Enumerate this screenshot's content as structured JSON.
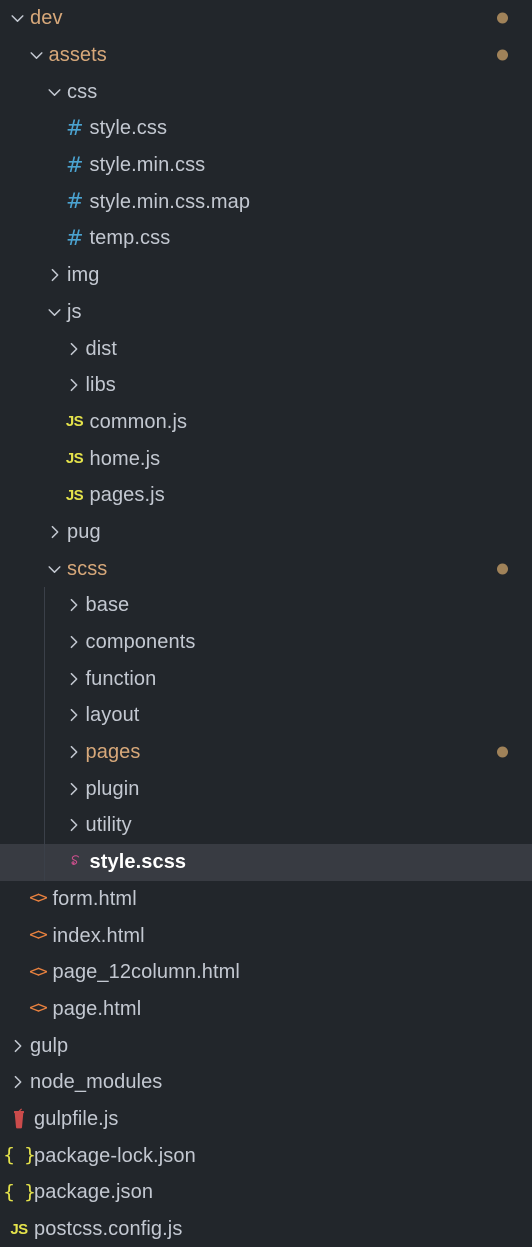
{
  "theme": {
    "background": "#22262b",
    "selected_row_background": "#383b42",
    "text_color": "#c3c8d1",
    "modified_color": "#d7a87a",
    "selected_text_color": "#ffffff",
    "badge_dot_color": "#a08259",
    "indent_guide_color": "#3b4049",
    "icon_css_color": "#4ba3d1",
    "icon_js_color": "#e5e34b",
    "icon_json_color": "#e5e34b",
    "icon_html_color": "#e8813f",
    "icon_scss_color": "#cf4f8e",
    "icon_gulp_color": "#cb4b4b"
  },
  "tree": [
    {
      "label": "dev",
      "depth": 0,
      "kind": "folder",
      "icon": "chevron-down-icon",
      "expanded": true,
      "modified": true,
      "dot": true,
      "selected": false,
      "guide": false
    },
    {
      "label": "assets",
      "depth": 1,
      "kind": "folder",
      "icon": "chevron-down-icon",
      "expanded": true,
      "modified": true,
      "dot": true,
      "selected": false,
      "guide": false
    },
    {
      "label": "css",
      "depth": 2,
      "kind": "folder",
      "icon": "chevron-down-icon",
      "expanded": true,
      "modified": false,
      "dot": false,
      "selected": false,
      "guide": false
    },
    {
      "label": "style.css",
      "depth": 3,
      "kind": "file",
      "icon": "css-file-icon",
      "expanded": false,
      "modified": false,
      "dot": false,
      "selected": false,
      "guide": false
    },
    {
      "label": "style.min.css",
      "depth": 3,
      "kind": "file",
      "icon": "css-file-icon",
      "expanded": false,
      "modified": false,
      "dot": false,
      "selected": false,
      "guide": false
    },
    {
      "label": "style.min.css.map",
      "depth": 3,
      "kind": "file",
      "icon": "css-file-icon",
      "expanded": false,
      "modified": false,
      "dot": false,
      "selected": false,
      "guide": false
    },
    {
      "label": "temp.css",
      "depth": 3,
      "kind": "file",
      "icon": "css-file-icon",
      "expanded": false,
      "modified": false,
      "dot": false,
      "selected": false,
      "guide": false
    },
    {
      "label": "img",
      "depth": 2,
      "kind": "folder",
      "icon": "chevron-right-icon",
      "expanded": false,
      "modified": false,
      "dot": false,
      "selected": false,
      "guide": false
    },
    {
      "label": "js",
      "depth": 2,
      "kind": "folder",
      "icon": "chevron-down-icon",
      "expanded": true,
      "modified": false,
      "dot": false,
      "selected": false,
      "guide": false
    },
    {
      "label": "dist",
      "depth": 3,
      "kind": "folder",
      "icon": "chevron-right-icon",
      "expanded": false,
      "modified": false,
      "dot": false,
      "selected": false,
      "guide": false
    },
    {
      "label": "libs",
      "depth": 3,
      "kind": "folder",
      "icon": "chevron-right-icon",
      "expanded": false,
      "modified": false,
      "dot": false,
      "selected": false,
      "guide": false
    },
    {
      "label": "common.js",
      "depth": 3,
      "kind": "file",
      "icon": "js-file-icon",
      "expanded": false,
      "modified": false,
      "dot": false,
      "selected": false,
      "guide": false
    },
    {
      "label": "home.js",
      "depth": 3,
      "kind": "file",
      "icon": "js-file-icon",
      "expanded": false,
      "modified": false,
      "dot": false,
      "selected": false,
      "guide": false
    },
    {
      "label": "pages.js",
      "depth": 3,
      "kind": "file",
      "icon": "js-file-icon",
      "expanded": false,
      "modified": false,
      "dot": false,
      "selected": false,
      "guide": false
    },
    {
      "label": "pug",
      "depth": 2,
      "kind": "folder",
      "icon": "chevron-right-icon",
      "expanded": false,
      "modified": false,
      "dot": false,
      "selected": false,
      "guide": false
    },
    {
      "label": "scss",
      "depth": 2,
      "kind": "folder",
      "icon": "chevron-down-icon",
      "expanded": true,
      "modified": true,
      "dot": true,
      "selected": false,
      "guide": false
    },
    {
      "label": "base",
      "depth": 3,
      "kind": "folder",
      "icon": "chevron-right-icon",
      "expanded": false,
      "modified": false,
      "dot": false,
      "selected": false,
      "guide": true
    },
    {
      "label": "components",
      "depth": 3,
      "kind": "folder",
      "icon": "chevron-right-icon",
      "expanded": false,
      "modified": false,
      "dot": false,
      "selected": false,
      "guide": true
    },
    {
      "label": "function",
      "depth": 3,
      "kind": "folder",
      "icon": "chevron-right-icon",
      "expanded": false,
      "modified": false,
      "dot": false,
      "selected": false,
      "guide": true
    },
    {
      "label": "layout",
      "depth": 3,
      "kind": "folder",
      "icon": "chevron-right-icon",
      "expanded": false,
      "modified": false,
      "dot": false,
      "selected": false,
      "guide": true
    },
    {
      "label": "pages",
      "depth": 3,
      "kind": "folder",
      "icon": "chevron-right-icon",
      "expanded": false,
      "modified": true,
      "dot": true,
      "selected": false,
      "guide": true
    },
    {
      "label": "plugin",
      "depth": 3,
      "kind": "folder",
      "icon": "chevron-right-icon",
      "expanded": false,
      "modified": false,
      "dot": false,
      "selected": false,
      "guide": true
    },
    {
      "label": "utility",
      "depth": 3,
      "kind": "folder",
      "icon": "chevron-right-icon",
      "expanded": false,
      "modified": false,
      "dot": false,
      "selected": false,
      "guide": true
    },
    {
      "label": "style.scss",
      "depth": 3,
      "kind": "file",
      "icon": "scss-file-icon",
      "expanded": false,
      "modified": false,
      "dot": false,
      "selected": true,
      "guide": true
    },
    {
      "label": "form.html",
      "depth": 1,
      "kind": "file",
      "icon": "html-file-icon",
      "expanded": false,
      "modified": false,
      "dot": false,
      "selected": false,
      "guide": false
    },
    {
      "label": "index.html",
      "depth": 1,
      "kind": "file",
      "icon": "html-file-icon",
      "expanded": false,
      "modified": false,
      "dot": false,
      "selected": false,
      "guide": false
    },
    {
      "label": "page_12column.html",
      "depth": 1,
      "kind": "file",
      "icon": "html-file-icon",
      "expanded": false,
      "modified": false,
      "dot": false,
      "selected": false,
      "guide": false
    },
    {
      "label": "page.html",
      "depth": 1,
      "kind": "file",
      "icon": "html-file-icon",
      "expanded": false,
      "modified": false,
      "dot": false,
      "selected": false,
      "guide": false
    },
    {
      "label": "gulp",
      "depth": 0,
      "kind": "folder",
      "icon": "chevron-right-icon",
      "expanded": false,
      "modified": false,
      "dot": false,
      "selected": false,
      "guide": false
    },
    {
      "label": "node_modules",
      "depth": 0,
      "kind": "folder",
      "icon": "chevron-right-icon",
      "expanded": false,
      "modified": false,
      "dot": false,
      "selected": false,
      "guide": false
    },
    {
      "label": "gulpfile.js",
      "depth": 0,
      "kind": "file",
      "icon": "gulp-file-icon",
      "expanded": false,
      "modified": false,
      "dot": false,
      "selected": false,
      "guide": false
    },
    {
      "label": "package-lock.json",
      "depth": 0,
      "kind": "file",
      "icon": "json-file-icon",
      "expanded": false,
      "modified": false,
      "dot": false,
      "selected": false,
      "guide": false
    },
    {
      "label": "package.json",
      "depth": 0,
      "kind": "file",
      "icon": "json-file-icon",
      "expanded": false,
      "modified": false,
      "dot": false,
      "selected": false,
      "guide": false
    },
    {
      "label": "postcss.config.js",
      "depth": 0,
      "kind": "file",
      "icon": "js-file-icon",
      "expanded": false,
      "modified": false,
      "dot": false,
      "selected": false,
      "guide": false
    }
  ]
}
